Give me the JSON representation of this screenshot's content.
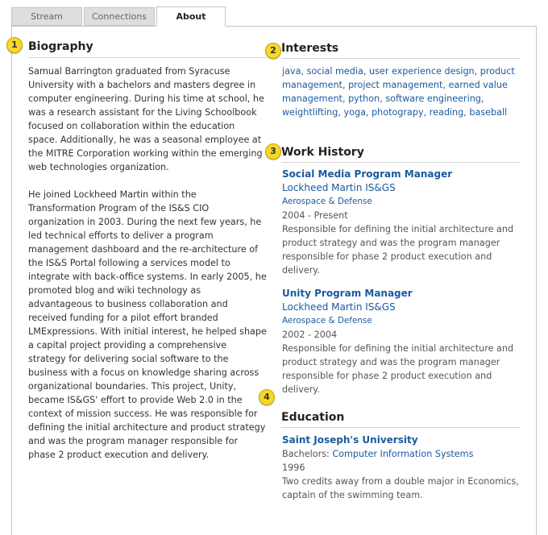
{
  "tabs": {
    "stream": "Stream",
    "connections": "Connections",
    "about": "About"
  },
  "badges": {
    "biography": "1",
    "interests": "2",
    "work_history": "3",
    "education": "4"
  },
  "biography": {
    "title": "Biography",
    "paragraph_1": "Samual Barrington graduated from Syracuse University with a bachelors and masters degree in computer engineering. During his time at school, he was a research assistant for the Living Schoolbook focused on collaboration within the education space. Additionally, he was a seasonal employee at the MITRE Corporation working within the emerging web technologies organization.",
    "paragraph_2": "He joined Lockheed Martin within the Transformation Program of the IS&S CIO organization in 2003. During the next few years, he led technical efforts to deliver a program management dashboard and the re-architecture of the IS&S Portal following a services model to integrate with back-office systems. In early 2005, he promoted blog and wiki technology as advantageous to business collaboration and received funding for a pilot effort branded LMExpressions. With initial interest, he helped shape a capital project providing a comprehensive strategy for delivering social software to the business with a focus on knowledge sharing across organizational boundaries. This project, Unity, became IS&GS' effort to provide Web 2.0 in the context of mission success. He was responsible for defining the initial architecture and product strategy and was the program manager responsible for phase 2 product execution and delivery."
  },
  "interests": {
    "title": "Interests",
    "items": [
      "java",
      "social media",
      "user experience design",
      "product management",
      "project management",
      "earned value management",
      "python",
      "software engineering",
      "weightlifting",
      "yoga",
      "photograpy",
      "reading",
      "baseball"
    ]
  },
  "work_history": {
    "title": "Work History",
    "jobs": [
      {
        "title": "Social Media Program Manager",
        "company": "Lockheed Martin IS&GS",
        "industry": "Aerospace & Defense",
        "dates": "2004 - Present",
        "description": "Responsible for defining the initial architecture and product strategy and was the program manager responsible for phase 2 product execution and delivery."
      },
      {
        "title": "Unity Program Manager",
        "company": "Lockheed Martin IS&GS",
        "industry": "Aerospace & Defense",
        "dates": "2002 - 2004",
        "description": "Responsible for defining the initial architecture and product strategy and was the program manager responsible for phase 2 product execution and delivery."
      }
    ]
  },
  "education": {
    "title": "Education",
    "school": "Saint Joseph's University",
    "degree_label": "Bachelors:",
    "field": "Computer Information Systems",
    "year": "1996",
    "notes": "Two credits away from a double major in Economics, captain of the swimming team."
  },
  "colors": {
    "link": "#1a5a9e",
    "badge": "#f7d72a",
    "border": "#c4c4c4"
  }
}
